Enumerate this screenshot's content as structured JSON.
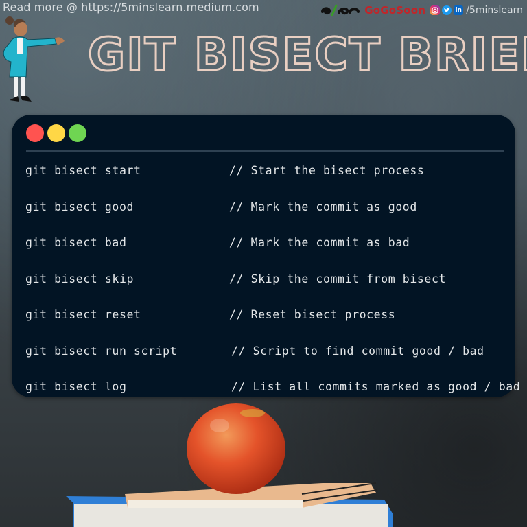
{
  "header": {
    "read_more": "Read more @ https://5minslearn.medium.com",
    "brand_name": "GoGoSoon",
    "social_handle": "/5minslearn",
    "social_icons": [
      "instagram-icon",
      "twitter-icon",
      "linkedin-icon"
    ],
    "linkedin_label": "in"
  },
  "title": "GIT BISECT BRIEF",
  "terminal": {
    "window_buttons": [
      {
        "name": "close",
        "color": "#ff5350"
      },
      {
        "name": "minimize",
        "color": "#ffd746"
      },
      {
        "name": "maximize",
        "color": "#6fd552"
      }
    ],
    "commands": [
      {
        "command": "git bisect start",
        "comment": "// Start the bisect process"
      },
      {
        "command": "git bisect good",
        "comment": "// Mark the commit as good"
      },
      {
        "command": "git bisect bad",
        "comment": "// Mark the commit as bad"
      },
      {
        "command": "git bisect skip",
        "comment": "// Skip the commit from bisect"
      },
      {
        "command": "git bisect reset",
        "comment": "// Reset bisect process"
      },
      {
        "command": "git bisect run script",
        "comment": "// Script to find commit good / bad"
      },
      {
        "command": "git bisect log",
        "comment": "// List all commits marked as good / bad"
      }
    ]
  },
  "colors": {
    "title_outline": "#e9cfc2",
    "terminal_bg": "#021424",
    "brand_red": "#c0262a"
  }
}
